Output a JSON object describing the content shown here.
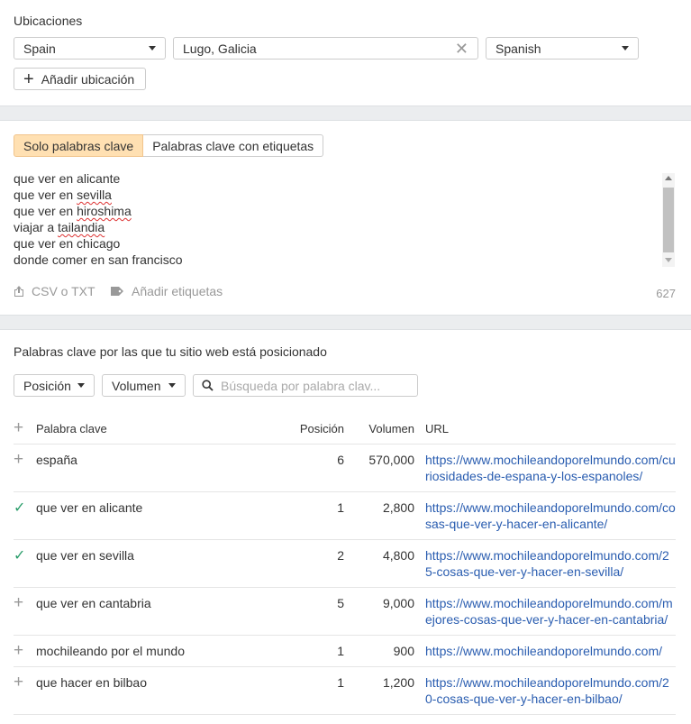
{
  "locations": {
    "label": "Ubicaciones",
    "country": "Spain",
    "city": "Lugo, Galicia",
    "language": "Spanish",
    "add_location": "Añadir ubicación"
  },
  "keywords_input": {
    "tab_only_keywords": "Solo palabras clave",
    "tab_with_tags": "Palabras clave con etiquetas",
    "lines": [
      {
        "pre": "que ver en alicante",
        "mark": ""
      },
      {
        "pre": "que ver en ",
        "mark": "sevilla"
      },
      {
        "pre": "que ver en ",
        "mark": "hiroshima"
      },
      {
        "pre": "viajar a ",
        "mark": "tailandia"
      },
      {
        "pre": "que ver en chicago",
        "mark": ""
      },
      {
        "pre": "donde comer en san francisco",
        "mark": ""
      }
    ],
    "csv_label": "CSV o TXT",
    "tags_label": "Añadir etiquetas",
    "char_count": "627"
  },
  "ranking": {
    "title": "Palabras clave por las que tu sitio web está posicionado",
    "filter_position": "Posición",
    "filter_volume": "Volumen",
    "search_placeholder": "Búsqueda por palabra clav...",
    "columns": {
      "keyword": "Palabra clave",
      "position": "Posición",
      "volume": "Volumen",
      "url": "URL"
    },
    "rows": [
      {
        "icon": "plus",
        "keyword": "españa",
        "position": "6",
        "volume": "570,000",
        "url": "https://www.mochileandoporelmundo.com/curiosidades-de-espana-y-los-espanoles/"
      },
      {
        "icon": "check",
        "keyword": "que ver en alicante",
        "position": "1",
        "volume": "2,800",
        "url": "https://www.mochileandoporelmundo.com/cosas-que-ver-y-hacer-en-alicante/"
      },
      {
        "icon": "check",
        "keyword": "que ver en sevilla",
        "position": "2",
        "volume": "4,800",
        "url": "https://www.mochileandoporelmundo.com/25-cosas-que-ver-y-hacer-en-sevilla/"
      },
      {
        "icon": "plus",
        "keyword": "que ver en cantabria",
        "position": "5",
        "volume": "9,000",
        "url": "https://www.mochileandoporelmundo.com/mejores-cosas-que-ver-y-hacer-en-cantabria/"
      },
      {
        "icon": "plus",
        "keyword": "mochileando por el mundo",
        "position": "1",
        "volume": "900",
        "url": "https://www.mochileandoporelmundo.com/"
      },
      {
        "icon": "plus",
        "keyword": "que hacer en bilbao",
        "position": "1",
        "volume": "1,200",
        "url": "https://www.mochileandoporelmundo.com/20-cosas-que-ver-y-hacer-en-bilbao/"
      }
    ]
  },
  "colors": {
    "accent_tab": "#ffe0b2",
    "link": "#2a5db0",
    "check": "#2a9d6a"
  }
}
